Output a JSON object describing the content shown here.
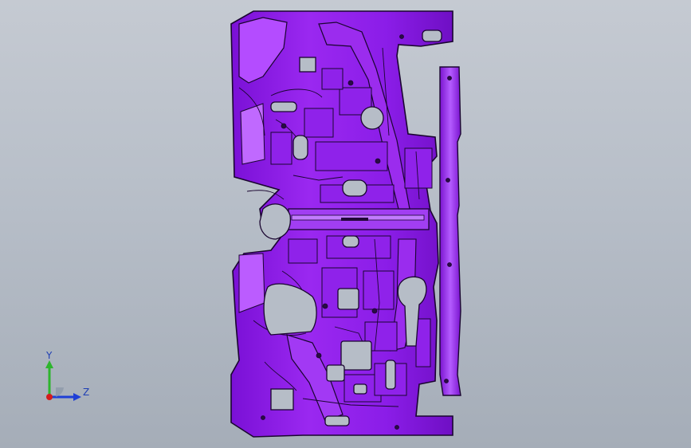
{
  "viewport": {
    "background_top": "#c5cad2",
    "background_bottom": "#a5adb8",
    "model": {
      "icon": "sheet-metal-panel",
      "face_color": "#8b1de8",
      "face_highlight": "#b64cff",
      "edge_color": "#1a0530"
    }
  },
  "triad": {
    "y_label": "Y",
    "z_label": "Z",
    "y_color": "#2db52d",
    "z_color": "#1f3fd6",
    "x_color": "#d51b1b"
  }
}
